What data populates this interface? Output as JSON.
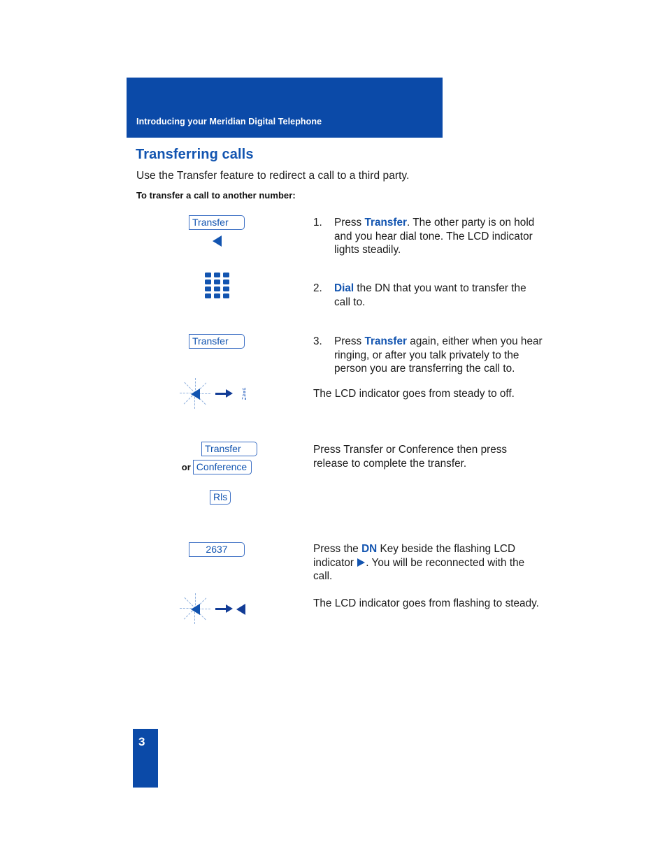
{
  "header": {
    "running_title": "Introducing your Meridian Digital Telephone",
    "bar_color": "#0B4AA8"
  },
  "section": {
    "heading": "Transferring calls",
    "heading_color": "#1254B0",
    "intro": "Use the Transfer feature to redirect a call to a third party.",
    "subheading": "To transfer a call to another number:"
  },
  "steps": [
    {
      "number": "1.",
      "key_label": "Transfer",
      "icon": "feature-key-with-lcd-triangle",
      "text_before": "Press ",
      "keyword": "Transfer",
      "text_after": ". The other party is on hold and you hear dial tone. The LCD indicator lights steadily."
    },
    {
      "number": "2.",
      "icon": "dial-pad",
      "text_before": "",
      "keyword": "Dial",
      "text_after": " the DN that you want to transfer the call to."
    },
    {
      "number": "3.",
      "key_label": "Transfer",
      "icon": "feature-key",
      "text_before": "Press ",
      "keyword": "Transfer",
      "text_after": " again, either when you hear ringing, or after you talk privately to the person you are transferring the call to."
    }
  ],
  "transitions": {
    "steady_to_off": {
      "icon": "lcd-steady-to-off",
      "caption": "The LCD indicator goes from steady to off."
    },
    "flashing_to_steady": {
      "icon": "lcd-flashing-to-steady",
      "caption": "The LCD indicator goes from flashing to steady."
    }
  },
  "transfer_or_conference": {
    "key_transfer": "Transfer",
    "or_label": "or",
    "key_conference": "Conference",
    "key_release": "Rls",
    "text": "Press Transfer or Conference then press release to complete the transfer."
  },
  "reconnect": {
    "dn_key_label": "2637",
    "text_before": "Press the ",
    "keyword": "DN",
    "text_middle": " Key beside the flashing LCD indicator ",
    "text_after": ". You will be reconnected with the call."
  },
  "page": {
    "number": "3"
  }
}
